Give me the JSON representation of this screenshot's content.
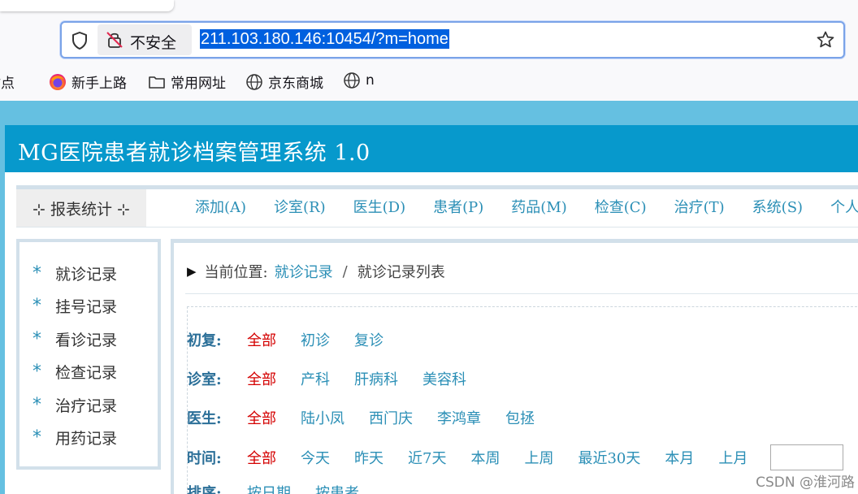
{
  "browser": {
    "insecure_label": "不安全",
    "url": "211.103.180.146:10454/?m=home",
    "bookmarks": [
      {
        "label": "站点",
        "icon": "partial-item"
      },
      {
        "label": "新手上路",
        "icon": "firefox-icon"
      },
      {
        "label": "常用网址",
        "icon": "folder-icon"
      },
      {
        "label": "京东商城",
        "icon": "globe-icon"
      },
      {
        "label": "n",
        "icon": "globe-icon"
      }
    ]
  },
  "app": {
    "title": "MG医院患者就诊档案管理系统 1.0",
    "report_menu": "⊹ 报表统计 ⊹",
    "menu": [
      "添加(A)",
      "诊室(R)",
      "医生(D)",
      "患者(P)",
      "药品(M)",
      "检查(C)",
      "治疗(T)",
      "系统(S)",
      "个人"
    ]
  },
  "sidebar": {
    "items": [
      "就诊记录",
      "挂号记录",
      "看诊记录",
      "检查记录",
      "治疗记录",
      "用药记录"
    ]
  },
  "breadcrumb": {
    "prefix": "当前位置:",
    "link": "就诊记录",
    "separator": "/",
    "current": "就诊记录列表"
  },
  "filters": {
    "visit_type": {
      "label": "初复:",
      "options": [
        "全部",
        "初诊",
        "复诊"
      ],
      "active": 0
    },
    "room": {
      "label": "诊室:",
      "options": [
        "全部",
        "产科",
        "肝病科",
        "美容科"
      ],
      "active": 0
    },
    "doctor": {
      "label": "医生:",
      "options": [
        "全部",
        "陆小凤",
        "西门庆",
        "李鸿章",
        "包拯"
      ],
      "active": 0
    },
    "time": {
      "label": "时间:",
      "options": [
        "全部",
        "今天",
        "昨天",
        "近7天",
        "本周",
        "上周",
        "最近30天",
        "本月",
        "上月"
      ],
      "active": 0
    },
    "sort": {
      "label": "排序:",
      "options": [
        "按日期",
        "按患者"
      ]
    }
  },
  "watermark": "CSDN @淮河路",
  "colors": {
    "banner": "#0799cc",
    "page_bg": "#65c0e1",
    "link": "#2b8fb6",
    "active": "#d40000",
    "url_highlight": "#0060df"
  }
}
